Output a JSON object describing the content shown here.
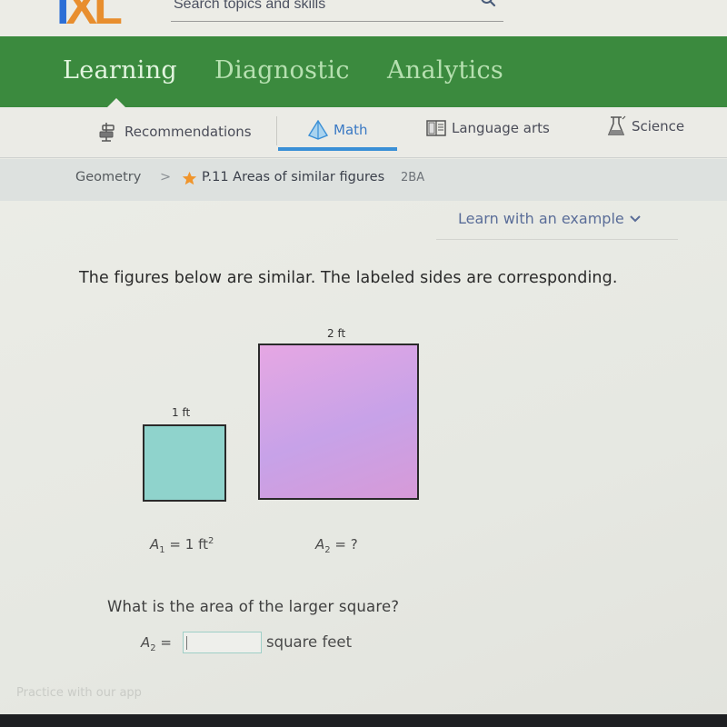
{
  "header": {
    "logo": {
      "i": "I",
      "xl": "XL"
    },
    "search_placeholder": "Search topics and skills"
  },
  "main_nav": {
    "tabs": [
      {
        "label": "Learning",
        "active": true
      },
      {
        "label": "Diagnostic",
        "active": false
      },
      {
        "label": "Analytics",
        "active": false
      }
    ]
  },
  "subject_nav": {
    "tabs": [
      {
        "label": "Recommendations",
        "icon": "signpost-icon",
        "active": false
      },
      {
        "label": "Math",
        "icon": "pyramid-icon",
        "active": true
      },
      {
        "label": "Language arts",
        "icon": "book-icon",
        "active": false
      },
      {
        "label": "Science",
        "icon": "flask-icon",
        "active": false
      }
    ]
  },
  "breadcrumb": {
    "category": "Geometry",
    "separator": ">",
    "skill": "P.11 Areas of similar figures",
    "code": "2BA"
  },
  "learn_example": "Learn with an example",
  "problem": {
    "statement": "The figures below are similar. The labeled sides are corresponding.",
    "small_square": {
      "side_label": "1 ft",
      "area_var": "A",
      "area_sub": "1",
      "area_value": "= 1 ft",
      "area_sup": "2",
      "fill_color": "#8fd3cc"
    },
    "large_square": {
      "side_label": "2 ft",
      "area_var": "A",
      "area_sub": "2",
      "area_value": "= ?",
      "fill_color": "#d9a5e6"
    },
    "question": "What is the area of the larger square?",
    "answer": {
      "var": "A",
      "sub": "2",
      "equals": "=",
      "value": "",
      "unit": "square feet"
    }
  },
  "footer": {
    "app_link": "Practice with our app"
  }
}
